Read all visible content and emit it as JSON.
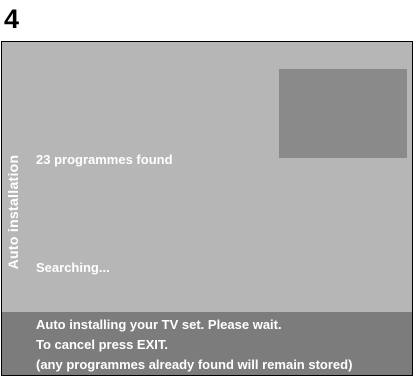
{
  "step": {
    "number": "4"
  },
  "screen": {
    "side_title": "Auto installation",
    "programmes_found": "23 programmes found",
    "status": "Searching..."
  },
  "info": {
    "lines": [
      "Auto installing your TV set. Please wait.",
      "To cancel press EXIT.",
      "(any programmes already found will remain stored)"
    ]
  },
  "colors": {
    "screen_background": "#b6b6b6",
    "info_panel_background": "#7c7c7c",
    "preview_window": "#8a8a8a",
    "text": "#ffffff"
  }
}
